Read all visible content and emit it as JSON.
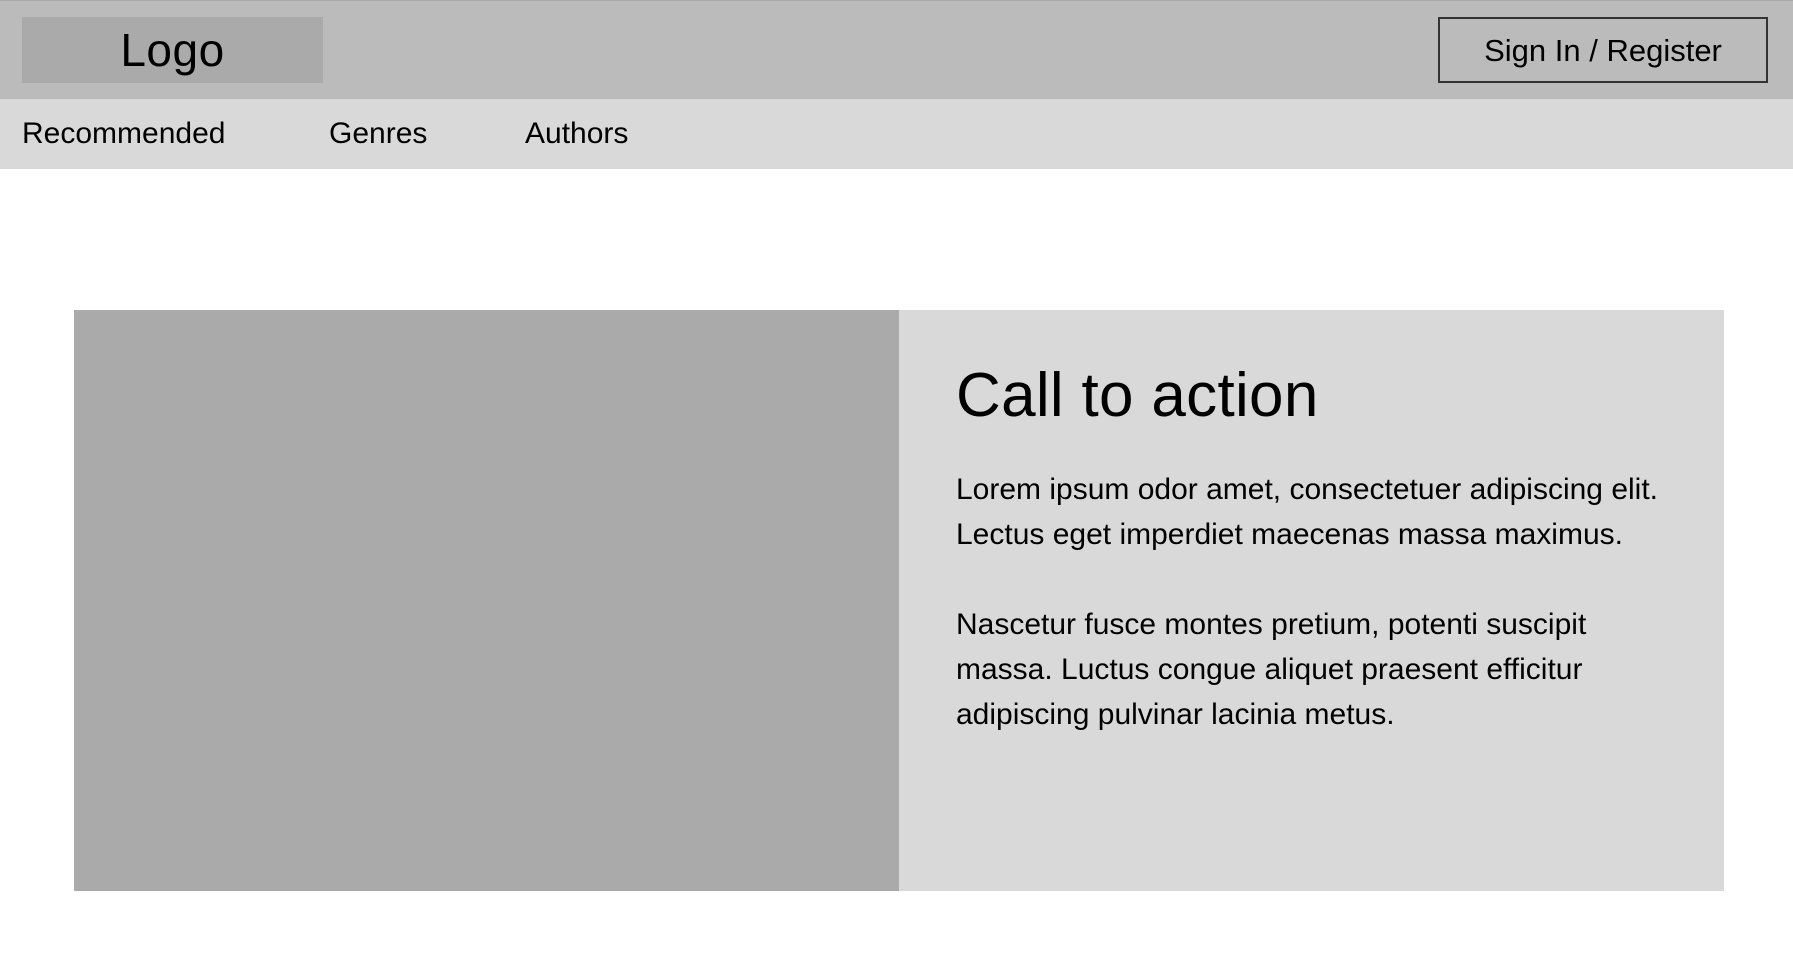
{
  "header": {
    "logo_text": "Logo",
    "auth_button_label": "Sign In / Register"
  },
  "nav": {
    "items": [
      {
        "label": "Recommended"
      },
      {
        "label": "Genres"
      },
      {
        "label": "Authors"
      }
    ]
  },
  "hero": {
    "title": "Call to action",
    "paragraphs": [
      "Lorem ipsum odor amet, consectetuer adipiscing elit. Lectus eget imperdiet maecenas massa maximus.",
      "Nascetur fusce montes pretium, potenti suscipit massa. Luctus congue aliquet praesent efficitur adipiscing pulvinar lacinia metus."
    ]
  },
  "colors": {
    "header_bg": "#bbbbbb",
    "logo_bg": "#aaaaaa",
    "nav_bg": "#d9d9d9",
    "image_placeholder": "#aaaaaa",
    "panel_bg": "#d9d9d9",
    "text": "#000000"
  }
}
